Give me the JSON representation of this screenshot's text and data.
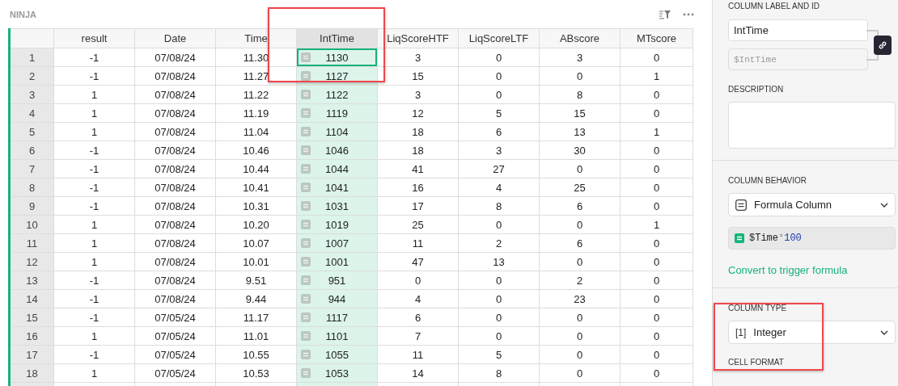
{
  "table": {
    "title": "NINJA",
    "columns": [
      {
        "label": "result",
        "selected": false
      },
      {
        "label": "Date",
        "selected": false
      },
      {
        "label": "Time",
        "selected": false
      },
      {
        "label": "IntTime",
        "selected": true,
        "kind": "formula"
      },
      {
        "label": "LiqScoreHTF",
        "selected": false
      },
      {
        "label": "LiqScoreLTF",
        "selected": false
      },
      {
        "label": "ABscore",
        "selected": false
      },
      {
        "label": "MTscore",
        "selected": false
      }
    ],
    "rows": [
      {
        "number": "1",
        "values": [
          "-1",
          "07/08/24",
          "11.30",
          "1130",
          "3",
          "0",
          "3",
          "0"
        ],
        "selected": true
      },
      {
        "number": "2",
        "values": [
          "-1",
          "07/08/24",
          "11.27",
          "1127",
          "15",
          "0",
          "0",
          "1"
        ],
        "selected": false
      },
      {
        "number": "3",
        "values": [
          "1",
          "07/08/24",
          "11.22",
          "1122",
          "3",
          "0",
          "8",
          "0"
        ],
        "selected": false
      },
      {
        "number": "4",
        "values": [
          "1",
          "07/08/24",
          "11.19",
          "1119",
          "12",
          "5",
          "15",
          "0"
        ],
        "selected": false
      },
      {
        "number": "5",
        "values": [
          "1",
          "07/08/24",
          "11.04",
          "1104",
          "18",
          "6",
          "13",
          "1"
        ],
        "selected": false
      },
      {
        "number": "6",
        "values": [
          "-1",
          "07/08/24",
          "10.46",
          "1046",
          "18",
          "3",
          "30",
          "0"
        ],
        "selected": false
      },
      {
        "number": "7",
        "values": [
          "-1",
          "07/08/24",
          "10.44",
          "1044",
          "41",
          "27",
          "0",
          "0"
        ],
        "selected": false
      },
      {
        "number": "8",
        "values": [
          "-1",
          "07/08/24",
          "10.41",
          "1041",
          "16",
          "4",
          "25",
          "0"
        ],
        "selected": false
      },
      {
        "number": "9",
        "values": [
          "-1",
          "07/08/24",
          "10.31",
          "1031",
          "17",
          "8",
          "6",
          "0"
        ],
        "selected": false
      },
      {
        "number": "10",
        "values": [
          "1",
          "07/08/24",
          "10.20",
          "1019",
          "25",
          "0",
          "0",
          "1"
        ],
        "selected": false
      },
      {
        "number": "11",
        "values": [
          "1",
          "07/08/24",
          "10.07",
          "1007",
          "11",
          "2",
          "6",
          "0"
        ],
        "selected": false
      },
      {
        "number": "12",
        "values": [
          "1",
          "07/08/24",
          "10.01",
          "1001",
          "47",
          "13",
          "0",
          "0"
        ],
        "selected": false
      },
      {
        "number": "13",
        "values": [
          "-1",
          "07/08/24",
          "9.51",
          "951",
          "0",
          "0",
          "2",
          "0"
        ],
        "selected": false
      },
      {
        "number": "14",
        "values": [
          "-1",
          "07/08/24",
          "9.44",
          "944",
          "4",
          "0",
          "23",
          "0"
        ],
        "selected": false
      },
      {
        "number": "15",
        "values": [
          "-1",
          "07/05/24",
          "11.17",
          "1117",
          "6",
          "0",
          "0",
          "0"
        ],
        "selected": false
      },
      {
        "number": "16",
        "values": [
          "1",
          "07/05/24",
          "11.01",
          "1101",
          "7",
          "0",
          "0",
          "0"
        ],
        "selected": false
      },
      {
        "number": "17",
        "values": [
          "-1",
          "07/05/24",
          "10.55",
          "1055",
          "11",
          "5",
          "0",
          "0"
        ],
        "selected": false
      },
      {
        "number": "18",
        "values": [
          "1",
          "07/05/24",
          "10.53",
          "1053",
          "14",
          "8",
          "0",
          "0"
        ],
        "selected": false
      }
    ]
  },
  "panel": {
    "label_heading": "COLUMN LABEL AND ID",
    "label_value": "IntTime",
    "id_value": "$IntTime",
    "description_heading": "DESCRIPTION",
    "behavior_heading": "COLUMN BEHAVIOR",
    "behavior_value": "Formula Column",
    "formula": [
      {
        "text": "$Time",
        "kind": "ref"
      },
      {
        "text": "*",
        "kind": "op"
      },
      {
        "text": "100",
        "kind": "number"
      }
    ],
    "convert_link": "Convert to trigger formula",
    "type_heading": "COLUMN TYPE",
    "type_glyph": "[1]",
    "type_value": "Integer",
    "format_heading": "CELL FORMAT"
  }
}
